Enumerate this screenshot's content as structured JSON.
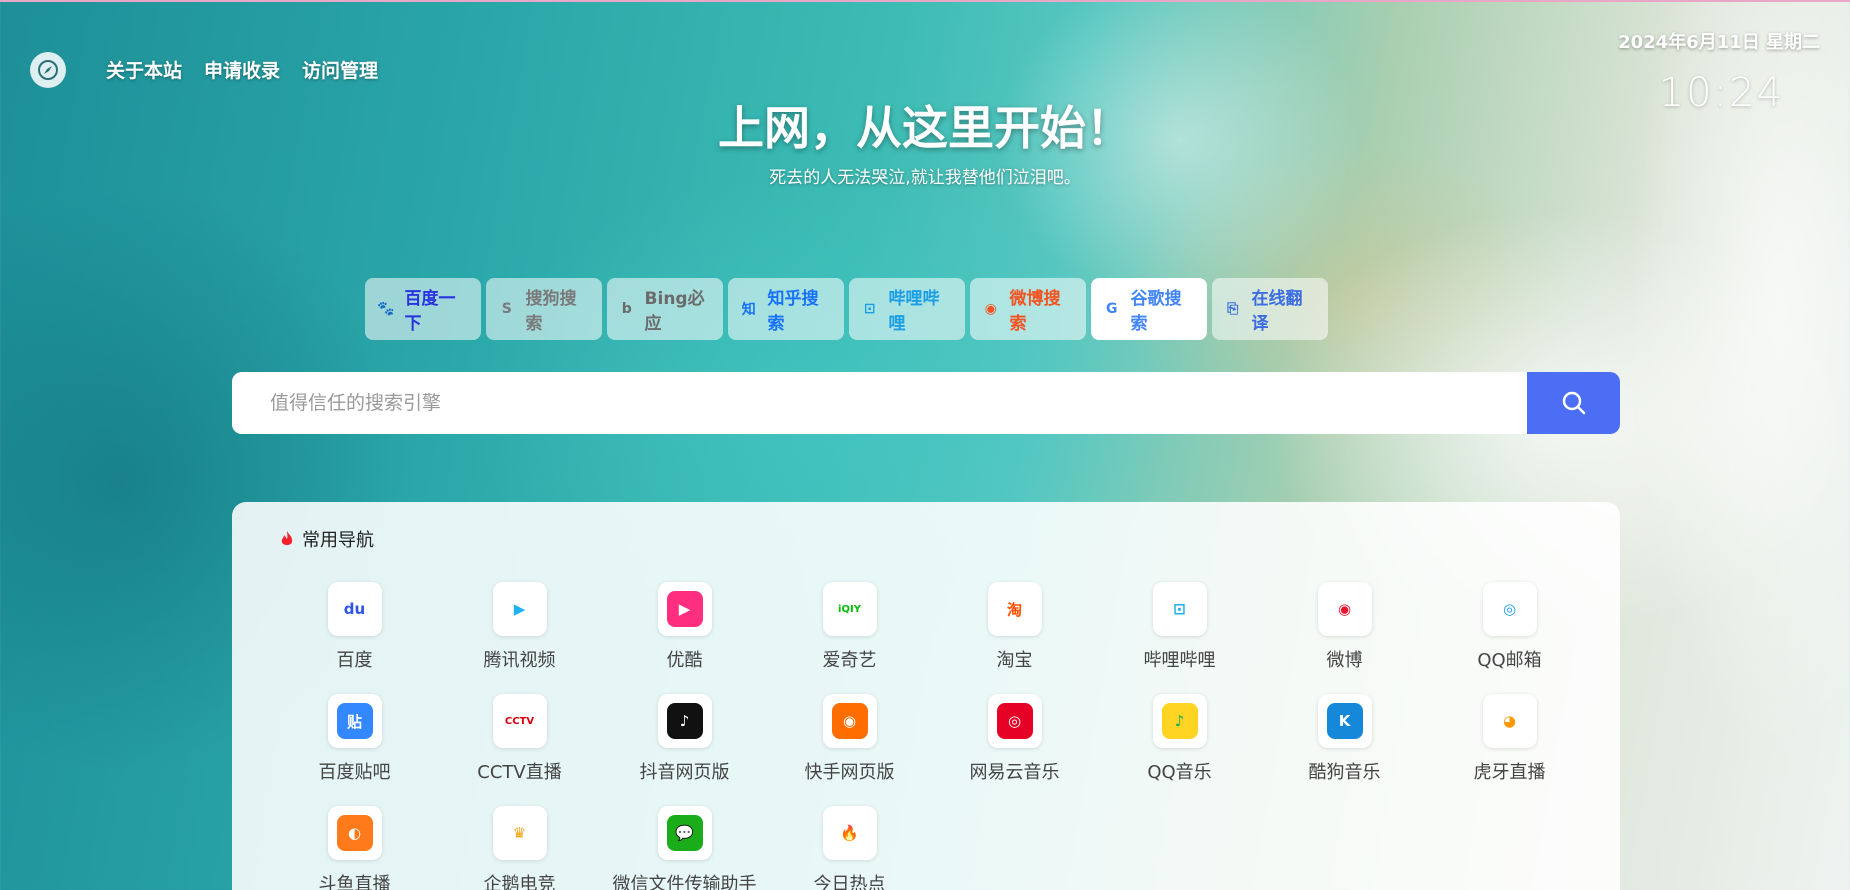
{
  "header": {
    "nav": [
      "关于本站",
      "申请收录",
      "访问管理"
    ],
    "date": "2024年6月11日 星期二",
    "time": "10:24"
  },
  "hero": {
    "title": "上网，从这里开始！",
    "subtitle": "死去的人无法哭泣,就让我替他们泣泪吧。"
  },
  "engines": [
    {
      "label": "百度一下",
      "icon": "baidu-paw-icon",
      "color": "#2932e1",
      "glyph": "🐾",
      "active": false,
      "width": 116
    },
    {
      "label": "搜狗搜索",
      "icon": "sogou-icon",
      "color": "#7a7a7a",
      "glyph": "S",
      "active": false,
      "width": 116
    },
    {
      "label": "Bing必应",
      "icon": "bing-icon",
      "color": "#6b6b6b",
      "glyph": "b",
      "active": false,
      "width": 116
    },
    {
      "label": "知乎搜索",
      "icon": "zhihu-icon",
      "color": "#1772f6",
      "glyph": "知",
      "active": false,
      "width": 116
    },
    {
      "label": "哔哩哔哩",
      "icon": "bilibili-icon",
      "color": "#1b9ee6",
      "glyph": "⊡",
      "active": false,
      "width": 116
    },
    {
      "label": "微博搜索",
      "icon": "weibo-icon",
      "color": "#f25321",
      "glyph": "◉",
      "active": false,
      "width": 116
    },
    {
      "label": "谷歌搜索",
      "icon": "google-icon",
      "color": "#4285f4",
      "glyph": "G",
      "active": true,
      "width": 116
    },
    {
      "label": "在线翻译",
      "icon": "translate-icon",
      "color": "#3b6de0",
      "glyph": "⎘",
      "active": false,
      "width": 116
    }
  ],
  "search": {
    "placeholder": "值得信任的搜索引擎"
  },
  "panel": {
    "title": "常用导航"
  },
  "sites": [
    {
      "name": "百度",
      "icon": "baidu-icon",
      "bg": "#ffffff",
      "fg": "#2f54eb",
      "glyph": "du"
    },
    {
      "name": "腾讯视频",
      "icon": "tencent-video-icon",
      "bg": "#ffffff",
      "fg": "#21b2f3",
      "glyph": "▶"
    },
    {
      "name": "优酷",
      "icon": "youku-icon",
      "bg": "#ff2e7e",
      "fg": "#ffffff",
      "glyph": "▶"
    },
    {
      "name": "爱奇艺",
      "icon": "iqiyi-icon",
      "bg": "#ffffff",
      "fg": "#00be06",
      "glyph": "iQIY"
    },
    {
      "name": "淘宝",
      "icon": "taobao-icon",
      "bg": "#ffffff",
      "fg": "#ff5000",
      "glyph": "淘"
    },
    {
      "name": "哔哩哔哩",
      "icon": "bilibili-tv-icon",
      "bg": "#ffffff",
      "fg": "#1eb3e8",
      "glyph": "⊡"
    },
    {
      "name": "微博",
      "icon": "weibo-logo-icon",
      "bg": "#ffffff",
      "fg": "#e6162d",
      "glyph": "◉"
    },
    {
      "name": "QQ邮箱",
      "icon": "qqmail-icon",
      "bg": "#ffffff",
      "fg": "#1d9ff0",
      "glyph": "◎"
    },
    {
      "name": "百度贴吧",
      "icon": "tieba-icon",
      "bg": "#3388ff",
      "fg": "#ffffff",
      "glyph": "贴"
    },
    {
      "name": "CCTV直播",
      "icon": "cctv-icon",
      "bg": "#ffffff",
      "fg": "#d7000f",
      "glyph": "CCTV"
    },
    {
      "name": "抖音网页版",
      "icon": "douyin-icon",
      "bg": "#111111",
      "fg": "#ffffff",
      "glyph": "♪"
    },
    {
      "name": "快手网页版",
      "icon": "kuaishou-icon",
      "bg": "#ff6c00",
      "fg": "#ffffff",
      "glyph": "◉"
    },
    {
      "name": "网易云音乐",
      "icon": "netease-music-icon",
      "bg": "#e60026",
      "fg": "#ffffff",
      "glyph": "◎"
    },
    {
      "name": "QQ音乐",
      "icon": "qqmusic-icon",
      "bg": "#ffd321",
      "fg": "#14b15b",
      "glyph": "♪"
    },
    {
      "name": "酷狗音乐",
      "icon": "kugou-icon",
      "bg": "#1688d9",
      "fg": "#ffffff",
      "glyph": "K"
    },
    {
      "name": "虎牙直播",
      "icon": "huya-icon",
      "bg": "#ffffff",
      "fg": "#ff9a00",
      "glyph": "◕"
    },
    {
      "name": "斗鱼直播",
      "icon": "douyu-icon",
      "bg": "#ff7a1a",
      "fg": "#ffffff",
      "glyph": "◐"
    },
    {
      "name": "企鹅电竞",
      "icon": "penguin-esports-icon",
      "bg": "#ffffff",
      "fg": "#f3a312",
      "glyph": "♛"
    },
    {
      "name": "微信文件传输助手",
      "icon": "wechat-icon",
      "bg": "#1aad19",
      "fg": "#ffffff",
      "glyph": "💬"
    },
    {
      "name": "今日热点",
      "icon": "hot-flame-icon",
      "bg": "#ffffff",
      "fg": "#f5222d",
      "glyph": "🔥"
    }
  ]
}
